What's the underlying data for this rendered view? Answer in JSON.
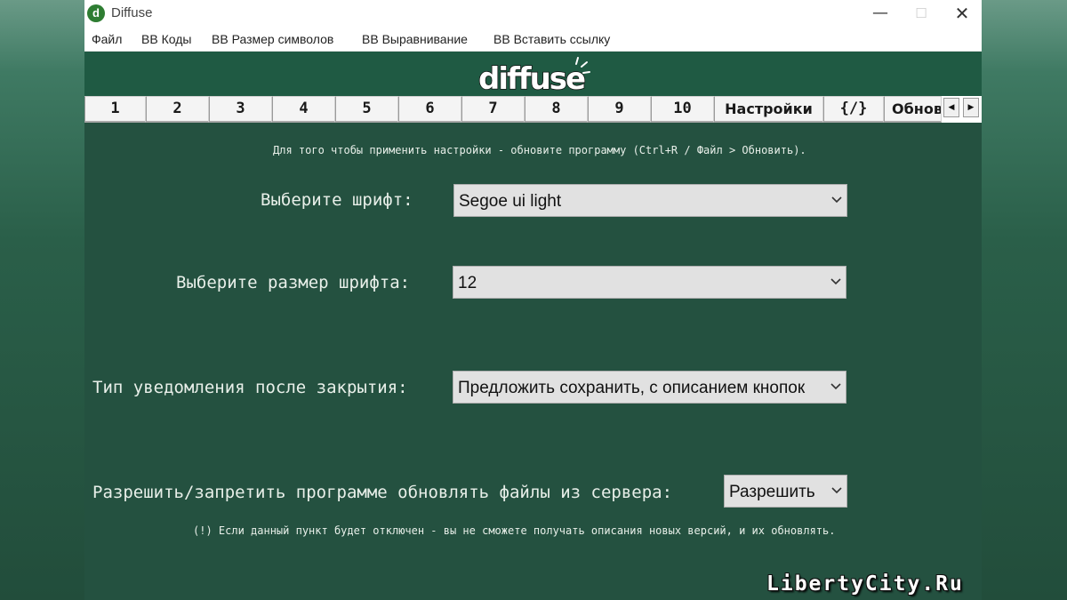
{
  "window": {
    "title": "Diffuse",
    "icon_letter": "d",
    "controls": {
      "minimize": "—",
      "maximize": "☐",
      "close": "✕"
    }
  },
  "menubar": {
    "items": [
      "Файл",
      "BB Коды",
      "BB Размер символов",
      "BB Выравнивание",
      "BB Вставить ссылку"
    ]
  },
  "banner": {
    "logo_text": "diffuse"
  },
  "tabs": {
    "items": [
      "1",
      "2",
      "3",
      "4",
      "5",
      "6",
      "7",
      "8",
      "9",
      "10",
      "Настройки",
      "{/}",
      "Обнов"
    ],
    "scroll_left": "◀",
    "scroll_right": "▶"
  },
  "settings": {
    "apply_hint": "Для того чтобы применить настройки - обновите программу (Ctrl+R / Файл > Обновить).",
    "font": {
      "label": "Выберите шрифт:",
      "value": "Segoe ui light"
    },
    "font_size": {
      "label": "Выберите размер шрифта:",
      "value": "12"
    },
    "close_notice": {
      "label": "Тип уведомления после закрытия:",
      "value": "Предложить сохранить, с описанием кнопок"
    },
    "updates": {
      "label": "Разрешить/запретить программе обновлять файлы из сервера:",
      "value": "Разрешить",
      "note": "(!) Если данный пункт будет отключен - вы не сможете получать описания новых версий, и их обновлять."
    }
  },
  "watermark": "LibertyCity.Ru",
  "colors": {
    "header_green": "#1f5a43",
    "content_green": "#245140",
    "text_light": "#e8efe9",
    "select_bg": "#e1e1e1"
  }
}
